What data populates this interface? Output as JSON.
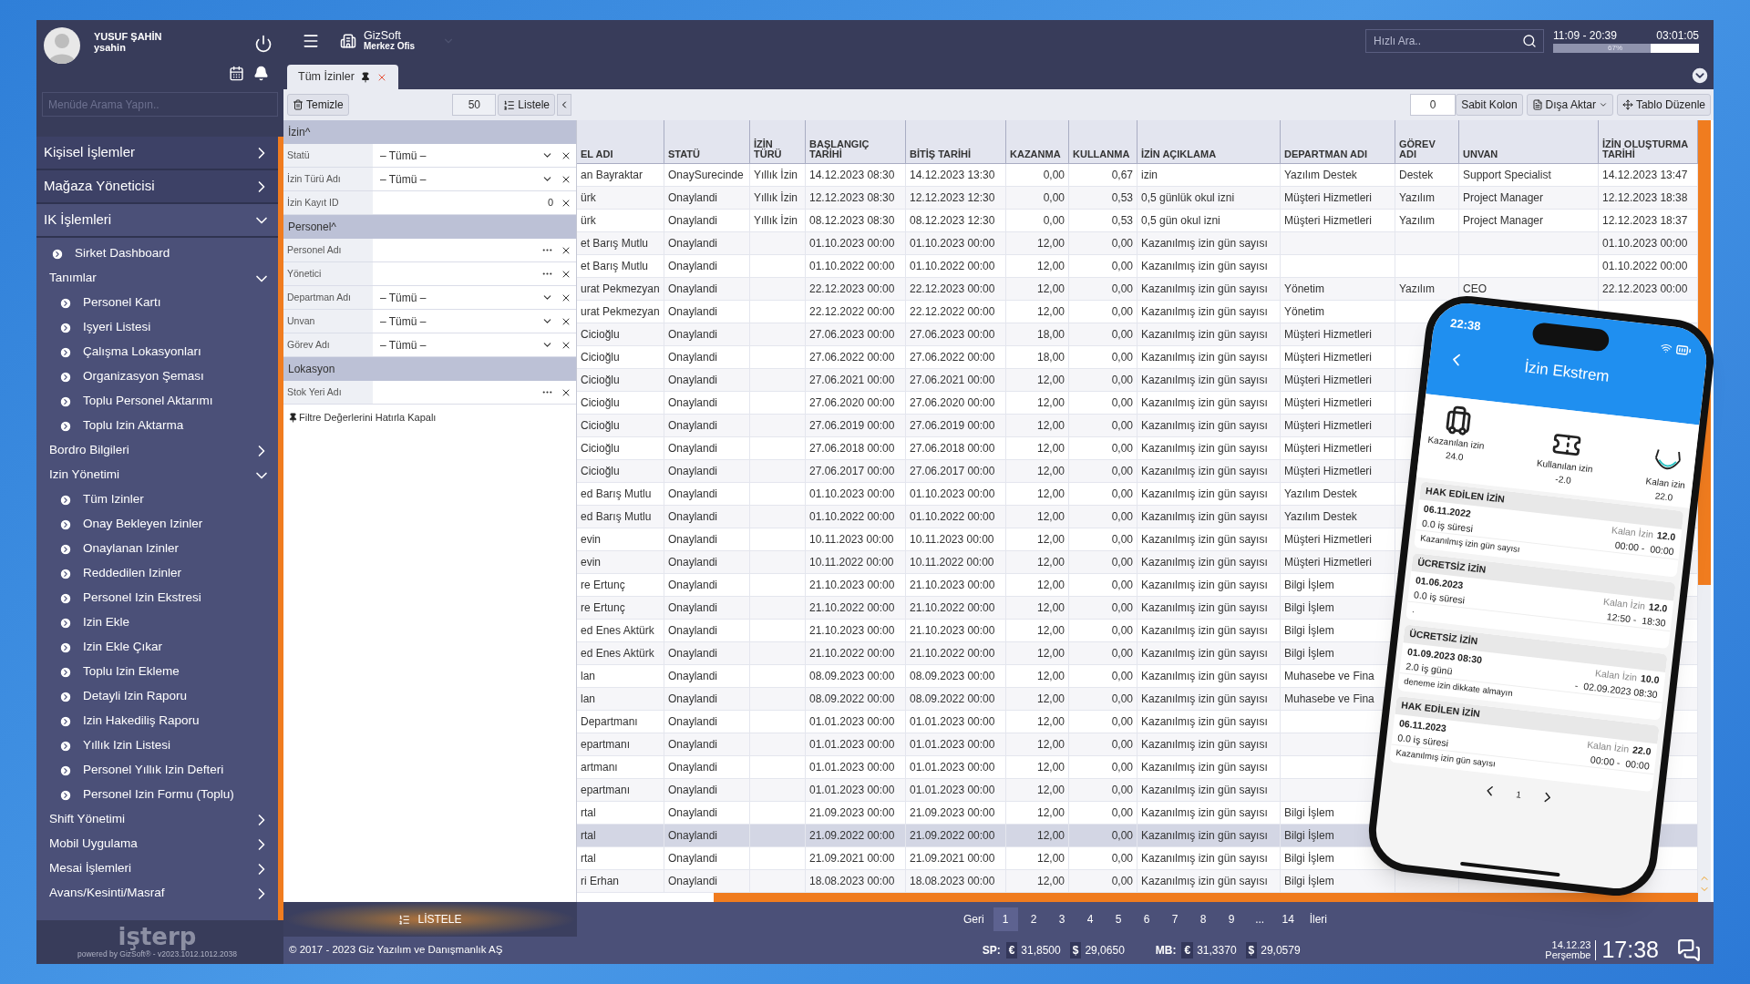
{
  "sidebar": {
    "user": {
      "name": "YUSUF ŞAHİN",
      "username": "ysahin"
    },
    "search": {
      "placeholder": "Menüde Arama Yapın.."
    },
    "menu": [
      {
        "label": "Kişisel İşlemler",
        "kind": "section",
        "expanded": false
      },
      {
        "label": "Mağaza Yöneticisi",
        "kind": "section",
        "expanded": false
      },
      {
        "label": "IK İşlemleri",
        "kind": "section",
        "expanded": true,
        "children": [
          {
            "label": "Sirket Dashboard",
            "kind": "link"
          },
          {
            "label": "Tanımlar",
            "kind": "group",
            "expanded": true,
            "children": [
              {
                "label": "Personel Kartı",
                "kind": "link"
              },
              {
                "label": "Işyeri Listesi",
                "kind": "link"
              },
              {
                "label": "Çalışma Lokasyonları",
                "kind": "link"
              },
              {
                "label": "Organizasyon Şeması",
                "kind": "link"
              },
              {
                "label": "Toplu Personel Aktarımı",
                "kind": "link"
              },
              {
                "label": "Toplu Izin Aktarma",
                "kind": "link"
              }
            ]
          },
          {
            "label": "Bordro Bilgileri",
            "kind": "group",
            "expanded": false
          },
          {
            "label": "Izin Yönetimi",
            "kind": "group",
            "expanded": true,
            "children": [
              {
                "label": "Tüm Izinler",
                "kind": "link"
              },
              {
                "label": "Onay Bekleyen Izinler",
                "kind": "link"
              },
              {
                "label": "Onaylanan Izinler",
                "kind": "link"
              },
              {
                "label": "Reddedilen Izinler",
                "kind": "link"
              },
              {
                "label": "Personel Izin Ekstresi",
                "kind": "link"
              },
              {
                "label": "Izin Ekle",
                "kind": "link"
              },
              {
                "label": "Izin Ekle Çıkar",
                "kind": "link"
              },
              {
                "label": "Toplu Izin Ekleme",
                "kind": "link"
              },
              {
                "label": "Detayli Izin Raporu",
                "kind": "link"
              },
              {
                "label": "Izin Hakediliş Raporu",
                "kind": "link"
              },
              {
                "label": "Yıllık Izin Listesi",
                "kind": "link"
              },
              {
                "label": "Personel Yıllık Izin Defteri",
                "kind": "link"
              },
              {
                "label": "Personel Izin Formu (Toplu)",
                "kind": "link"
              }
            ]
          },
          {
            "label": "Shift Yönetimi",
            "kind": "group",
            "expanded": false
          },
          {
            "label": "Mobil Uygulama",
            "kind": "group",
            "expanded": false
          },
          {
            "label": "Mesai İşlemleri",
            "kind": "group",
            "expanded": false
          },
          {
            "label": "Avans/Kesinti/Masraf",
            "kind": "group",
            "expanded": false
          }
        ]
      }
    ],
    "footer": {
      "logo": "işterp",
      "powered_by": "powered by GizSoft® - v2023.1012.1012.2038"
    }
  },
  "header": {
    "company": "GizSoft",
    "branch": "Merkez Ofis",
    "search": {
      "placeholder": "Hızlı Ara.."
    },
    "shift": "11:09 - 20:39",
    "elapsed": "03:01:05",
    "progress": {
      "level": 0.67,
      "label": "67%"
    }
  },
  "tabs": [
    {
      "label": "Tüm İzinler",
      "selected": true
    }
  ],
  "toolbar": {
    "clear": "Temizle",
    "page_size": "50",
    "list": "Listele",
    "fixed_count": "0",
    "fixed_columns": "Sabit Kolon",
    "export": "Dışa Aktar",
    "edit_table": "Tablo Düzenle"
  },
  "filters": {
    "sections": [
      {
        "title": "İzin^",
        "fields": [
          {
            "label": "Statü",
            "kind": "select",
            "value": "– Tümü –"
          },
          {
            "label": "İzin Türü Adı",
            "kind": "select",
            "value": "– Tümü –"
          },
          {
            "label": "İzin Kayıt ID",
            "kind": "number",
            "value": "0"
          }
        ]
      },
      {
        "title": "Personel^",
        "fields": [
          {
            "label": "Personel Adı",
            "kind": "lookup"
          },
          {
            "label": "Yönetici",
            "kind": "lookup"
          },
          {
            "label": "Departman Adı",
            "kind": "select",
            "value": "– Tümü –"
          },
          {
            "label": "Unvan",
            "kind": "select",
            "value": "– Tümü –"
          },
          {
            "label": "Görev Adı",
            "kind": "select",
            "value": "– Tümü –"
          }
        ]
      },
      {
        "title": "Lokasyon",
        "fields": [
          {
            "label": "Stok Yeri Adı",
            "kind": "lookup"
          }
        ]
      }
    ],
    "remember": "Filtre Değerlerini Hatırla Kapalı",
    "list_button": "LİSTELE"
  },
  "table": {
    "columns": [
      "EL ADI",
      "STATÜ",
      "İZİN TÜRÜ",
      "BAŞLANGIÇ TARİHİ",
      "BİTİŞ TARİHİ",
      "KAZANMA",
      "KULLANMA",
      "İZİN AÇIKLAMA",
      "DEPARTMAN ADI",
      "GÖREV ADI",
      "UNVAN",
      "İZİN OLUŞTURMA TARİHİ"
    ],
    "rows": [
      {
        "selected": false,
        "cells": [
          "an Bayraktar",
          "OnaySurecinde",
          "Yıllık İzin",
          "14.12.2023 08:30",
          "14.12.2023 13:30",
          "0,00",
          "0,67",
          "izin",
          "Yazılım Destek",
          "Destek",
          "Support Specialist",
          "14.12.2023 13:47"
        ]
      },
      {
        "selected": false,
        "cells": [
          "ürk",
          "Onaylandi",
          "Yıllık İzin",
          "12.12.2023 08:30",
          "12.12.2023 12:30",
          "0,00",
          "0,53",
          "0,5 günlük okul izni",
          "Müşteri Hizmetleri",
          "Yazılım",
          "Project Manager",
          "12.12.2023 18:38"
        ]
      },
      {
        "selected": false,
        "cells": [
          "ürk",
          "Onaylandi",
          "Yıllık İzin",
          "08.12.2023 08:30",
          "08.12.2023 12:30",
          "0,00",
          "0,53",
          "0,5 gün okul izni",
          "Müşteri Hizmetleri",
          "Yazılım",
          "Project Manager",
          "12.12.2023 18:37"
        ]
      },
      {
        "selected": false,
        "cells": [
          "et Barış Mutlu",
          "Onaylandi",
          null,
          "01.10.2023 00:00",
          "01.10.2023 00:00",
          "12,00",
          "0,00",
          "Kazanılmış izin gün sayısı",
          null,
          null,
          null,
          "01.10.2023 00:00"
        ]
      },
      {
        "selected": false,
        "cells": [
          "et Barış Mutlu",
          "Onaylandi",
          null,
          "01.10.2022 00:00",
          "01.10.2022 00:00",
          "12,00",
          "0,00",
          "Kazanılmış izin gün sayısı",
          null,
          null,
          null,
          "01.10.2022 00:00"
        ]
      },
      {
        "selected": false,
        "cells": [
          "urat Pekmezyan",
          "Onaylandi",
          null,
          "22.12.2023 00:00",
          "22.12.2023 00:00",
          "12,00",
          "0,00",
          "Kazanılmış izin gün sayısı",
          "Yönetim",
          "Yazılım",
          "CEO",
          "22.12.2023 00:00"
        ]
      },
      {
        "selected": false,
        "cells": [
          "urat Pekmezyan",
          "Onaylandi",
          null,
          "22.12.2022 00:00",
          "22.12.2022 00:00",
          "12,00",
          "0,00",
          "Kazanılmış izin gün sayısı",
          "Yönetim",
          null,
          null,
          null
        ]
      },
      {
        "selected": false,
        "cells": [
          "Cicioğlu",
          "Onaylandi",
          null,
          "27.06.2023 00:00",
          "27.06.2023 00:00",
          "18,00",
          "0,00",
          "Kazanılmış izin gün sayısı",
          "Müşteri Hizmetleri",
          null,
          null,
          null
        ]
      },
      {
        "selected": false,
        "cells": [
          "Cicioğlu",
          "Onaylandi",
          null,
          "27.06.2022 00:00",
          "27.06.2022 00:00",
          "18,00",
          "0,00",
          "Kazanılmış izin gün sayısı",
          "Müşteri Hizmetleri",
          null,
          null,
          null
        ]
      },
      {
        "selected": false,
        "cells": [
          "Cicioğlu",
          "Onaylandi",
          null,
          "27.06.2021 00:00",
          "27.06.2021 00:00",
          "12,00",
          "0,00",
          "Kazanılmış izin gün sayısı",
          "Müşteri Hizmetleri",
          null,
          null,
          null
        ]
      },
      {
        "selected": false,
        "cells": [
          "Cicioğlu",
          "Onaylandi",
          null,
          "27.06.2020 00:00",
          "27.06.2020 00:00",
          "12,00",
          "0,00",
          "Kazanılmış izin gün sayısı",
          "Müşteri Hizmetleri",
          null,
          null,
          null
        ]
      },
      {
        "selected": false,
        "cells": [
          "Cicioğlu",
          "Onaylandi",
          null,
          "27.06.2019 00:00",
          "27.06.2019 00:00",
          "12,00",
          "0,00",
          "Kazanılmış izin gün sayısı",
          "Müşteri Hizmetleri",
          null,
          null,
          null
        ]
      },
      {
        "selected": false,
        "cells": [
          "Cicioğlu",
          "Onaylandi",
          null,
          "27.06.2018 00:00",
          "27.06.2018 00:00",
          "12,00",
          "0,00",
          "Kazanılmış izin gün sayısı",
          "Müşteri Hizmetleri",
          null,
          null,
          null
        ]
      },
      {
        "selected": false,
        "cells": [
          "Cicioğlu",
          "Onaylandi",
          null,
          "27.06.2017 00:00",
          "27.06.2017 00:00",
          "12,00",
          "0,00",
          "Kazanılmış izin gün sayısı",
          "Müşteri Hizmetleri",
          null,
          null,
          null
        ]
      },
      {
        "selected": false,
        "cells": [
          "ed Barış Mutlu",
          "Onaylandi",
          null,
          "01.10.2023 00:00",
          "01.10.2023 00:00",
          "12,00",
          "0,00",
          "Kazanılmış izin gün sayısı",
          "Yazılım Destek",
          null,
          null,
          null
        ]
      },
      {
        "selected": false,
        "cells": [
          "ed Barış Mutlu",
          "Onaylandi",
          null,
          "01.10.2022 00:00",
          "01.10.2022 00:00",
          "12,00",
          "0,00",
          "Kazanılmış izin gün sayısı",
          "Yazılım Destek",
          null,
          null,
          null
        ]
      },
      {
        "selected": false,
        "cells": [
          "evin",
          "Onaylandi",
          null,
          "10.11.2023 00:00",
          "10.11.2023 00:00",
          "12,00",
          "0,00",
          "Kazanılmış izin gün sayısı",
          "Müşteri Hizmetleri",
          null,
          null,
          null
        ]
      },
      {
        "selected": false,
        "cells": [
          "evin",
          "Onaylandi",
          null,
          "10.11.2022 00:00",
          "10.11.2022 00:00",
          "12,00",
          "0,00",
          "Kazanılmış izin gün sayısı",
          "Müşteri Hizmetleri",
          null,
          null,
          null
        ]
      },
      {
        "selected": false,
        "cells": [
          "re Ertunç",
          "Onaylandi",
          null,
          "21.10.2023 00:00",
          "21.10.2023 00:00",
          "12,00",
          "0,00",
          "Kazanılmış izin gün sayısı",
          "Bilgi İşlem",
          null,
          null,
          null
        ]
      },
      {
        "selected": false,
        "cells": [
          "re Ertunç",
          "Onaylandi",
          null,
          "21.10.2022 00:00",
          "21.10.2022 00:00",
          "12,00",
          "0,00",
          "Kazanılmış izin gün sayısı",
          "Bilgi İşlem",
          null,
          null,
          null
        ]
      },
      {
        "selected": false,
        "cells": [
          "ed Enes Aktürk",
          "Onaylandi",
          null,
          "21.10.2023 00:00",
          "21.10.2023 00:00",
          "12,00",
          "0,00",
          "Kazanılmış izin gün sayısı",
          "Bilgi İşlem",
          null,
          null,
          null
        ]
      },
      {
        "selected": false,
        "cells": [
          "ed Enes Aktürk",
          "Onaylandi",
          null,
          "21.10.2022 00:00",
          "21.10.2022 00:00",
          "12,00",
          "0,00",
          "Kazanılmış izin gün sayısı",
          "Bilgi İşlem",
          null,
          null,
          null
        ]
      },
      {
        "selected": false,
        "cells": [
          "lan",
          "Onaylandi",
          null,
          "08.09.2023 00:00",
          "08.09.2023 00:00",
          "12,00",
          "0,00",
          "Kazanılmış izin gün sayısı",
          "Muhasebe ve Fina",
          null,
          null,
          null
        ]
      },
      {
        "selected": false,
        "cells": [
          "lan",
          "Onaylandi",
          null,
          "08.09.2022 00:00",
          "08.09.2022 00:00",
          "12,00",
          "0,00",
          "Kazanılmış izin gün sayısı",
          "Muhasebe ve Fina",
          null,
          null,
          null
        ]
      },
      {
        "selected": false,
        "cells": [
          "Departmanı",
          "Onaylandi",
          null,
          "01.01.2023 00:00",
          "01.01.2023 00:00",
          "12,00",
          "0,00",
          "Kazanılmış izin gün sayısı",
          null,
          null,
          null,
          null
        ]
      },
      {
        "selected": false,
        "cells": [
          "epartmanı",
          "Onaylandi",
          null,
          "01.01.2023 00:00",
          "01.01.2023 00:00",
          "12,00",
          "0,00",
          "Kazanılmış izin gün sayısı",
          null,
          null,
          null,
          null
        ]
      },
      {
        "selected": false,
        "cells": [
          "artmanı",
          "Onaylandi",
          null,
          "01.01.2023 00:00",
          "01.01.2023 00:00",
          "12,00",
          "0,00",
          "Kazanılmış izin gün sayısı",
          null,
          null,
          null,
          null
        ]
      },
      {
        "selected": false,
        "cells": [
          "epartmanı",
          "Onaylandi",
          null,
          "01.01.2023 00:00",
          "01.01.2023 00:00",
          "12,00",
          "0,00",
          "Kazanılmış izin gün sayısı",
          null,
          null,
          null,
          null
        ]
      },
      {
        "selected": false,
        "cells": [
          "rtal",
          "Onaylandi",
          null,
          "21.09.2023 00:00",
          "21.09.2023 00:00",
          "12,00",
          "0,00",
          "Kazanılmış izin gün sayısı",
          "Bilgi İşlem",
          null,
          null,
          null
        ]
      },
      {
        "selected": true,
        "cells": [
          "rtal",
          "Onaylandi",
          null,
          "21.09.2022 00:00",
          "21.09.2022 00:00",
          "12,00",
          "0,00",
          "Kazanılmış izin gün sayısı",
          "Bilgi İşlem",
          null,
          null,
          null
        ]
      },
      {
        "selected": false,
        "cells": [
          "rtal",
          "Onaylandi",
          null,
          "21.09.2021 00:00",
          "21.09.2021 00:00",
          "12,00",
          "0,00",
          "Kazanılmış izin gün sayısı",
          "Bilgi İşlem",
          null,
          null,
          null
        ]
      },
      {
        "selected": false,
        "cells": [
          "ri Erhan",
          "Onaylandi",
          null,
          "18.08.2023 00:00",
          "18.08.2023 00:00",
          "12,00",
          "0,00",
          "Kazanılmış izin gün sayısı",
          "Bilgi İşlem",
          null,
          null,
          null
        ]
      }
    ]
  },
  "pagination": {
    "prev": "Geri",
    "next": "İleri",
    "pages": [
      {
        "label": "1",
        "selected": true
      },
      {
        "label": "2",
        "selected": false
      },
      {
        "label": "3",
        "selected": false
      },
      {
        "label": "4",
        "selected": false
      },
      {
        "label": "5",
        "selected": false
      },
      {
        "label": "6",
        "selected": false
      },
      {
        "label": "7",
        "selected": false
      },
      {
        "label": "8",
        "selected": false
      },
      {
        "label": "9",
        "selected": false
      },
      {
        "label": "...",
        "selected": false
      },
      {
        "label": "14",
        "selected": false
      }
    ]
  },
  "status_bar": {
    "copyright": "© 2017 - 2023 Giz Yazılım ve Danışmanlık AŞ",
    "rates": [
      {
        "label": "SP:",
        "values": [
          {
            "symbol": "€",
            "value": "31,8500"
          },
          {
            "symbol": "$",
            "value": "29,0650"
          }
        ]
      },
      {
        "label": "MB:",
        "values": [
          {
            "symbol": "€",
            "value": "31,3370"
          },
          {
            "symbol": "$",
            "value": "29,0579"
          }
        ]
      }
    ],
    "date": "14.12.23",
    "weekday": "Perşembe",
    "time": "17:38"
  },
  "phone": {
    "status_time": "22:38",
    "title": "İzin Ekstrem",
    "summary": [
      {
        "kind": "luggage",
        "label": "Kazanılan izin",
        "value": "24.0"
      },
      {
        "kind": "ticket",
        "label": "Kullanılan izin",
        "value": "-2.0"
      },
      {
        "kind": "hammock",
        "label": "Kalan izin",
        "value": "22.0"
      }
    ],
    "entries": [
      {
        "type": "HAK EDİLEN İZİN",
        "date": "06.11.2022",
        "remaining_label": "Kalan İzin",
        "remaining": "12.0",
        "duration": "0.0 iş süresi",
        "time_from": "00:00 -",
        "time_to": "00:00",
        "note": "Kazanılmış izin gün sayısı"
      },
      {
        "type": "ÜCRETSİZ İZİN",
        "date": "01.06.2023",
        "remaining_label": "Kalan İzin",
        "remaining": "12.0",
        "duration": "0.0 iş süresi",
        "time_from": "12:50 -",
        "time_to": "18:30",
        "note": "."
      },
      {
        "type": "ÜCRETSİZ İZİN",
        "date": "01.09.2023 08:30",
        "remaining_label": "Kalan İzin",
        "remaining": "10.0",
        "duration": "2.0 iş günü",
        "time_from": "-",
        "time_to": "02.09.2023 08:30",
        "note": "deneme izin dikkate almayın"
      },
      {
        "type": "HAK EDİLEN İZİN",
        "date": "06.11.2023",
        "remaining_label": "Kalan İzin",
        "remaining": "22.0",
        "duration": "0.0 iş süresi",
        "time_from": "00:00 -",
        "time_to": "00:00",
        "note": "Kazanılmış izin gün sayısı"
      }
    ],
    "page": "1"
  }
}
